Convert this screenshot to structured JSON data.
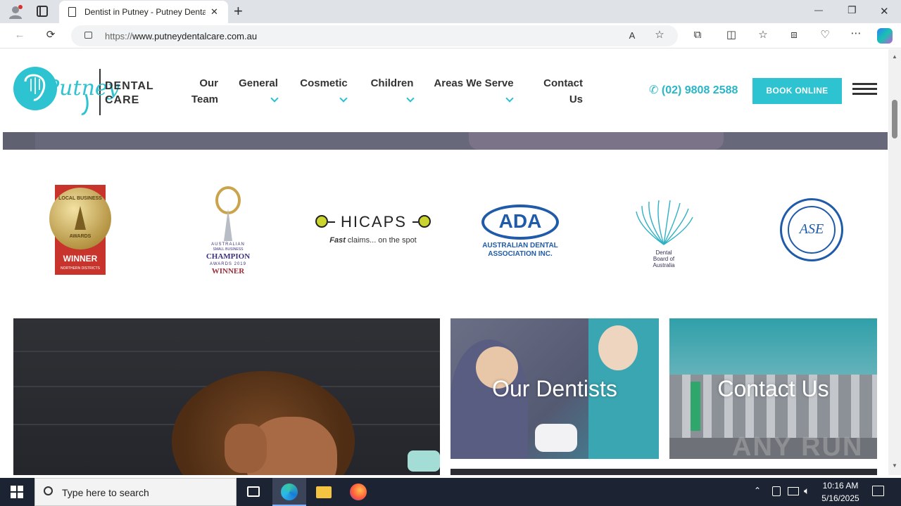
{
  "browser": {
    "tab_title": "Dentist in Putney - Putney Dental",
    "url_prefix": "https://",
    "url_host": "www.putneydentalcare.com.au",
    "new_tab_glyph": "+",
    "min_glyph": "—",
    "restore_glyph": "❐",
    "close_glyph": "✕",
    "tab_close_glyph": "✕"
  },
  "site": {
    "logo_script": "Putney",
    "logo_line1": "DENTAL",
    "logo_line2": "CARE",
    "nav": [
      {
        "line1": "Our",
        "line2": "Team",
        "dropdown": false
      },
      {
        "line1": "General",
        "line2": "",
        "dropdown": true
      },
      {
        "line1": "Cosmetic",
        "line2": "",
        "dropdown": true
      },
      {
        "line1": "Children",
        "line2": "",
        "dropdown": true
      },
      {
        "line1": "Areas We Serve",
        "line2": "",
        "dropdown": true
      },
      {
        "line1": "Contact",
        "line2": "Us",
        "dropdown": false
      }
    ],
    "phone": "(02) 9808 2588",
    "book_label": "BOOK ONLINE",
    "accent": "#2ec3d1"
  },
  "badges": {
    "local_business": {
      "top": "LOCAL BUSINESS",
      "mid": "AWARDS",
      "winner": "WINNER",
      "sub": "NORTHERN DISTRICTS"
    },
    "champion": {
      "l1": "AUSTRALIAN",
      "l2": "SMALL BUSINESS",
      "l3": "CHAMPION",
      "l4": "AWARDS 2019",
      "l5": "WINNER"
    },
    "hicaps": {
      "name": "HICAPS",
      "tag_bold": "Fast",
      "tag_rest": " claims... on the spot"
    },
    "ada": {
      "abbr": "ADA",
      "l1": "AUSTRALIAN DENTAL",
      "l2": "ASSOCIATION INC."
    },
    "dental_board": {
      "l1": "Dental",
      "l2": "Board of",
      "l3": "Australia"
    },
    "society": {
      "mono": "ASE"
    }
  },
  "tiles": {
    "dentists_label": "Our Dentists",
    "contact_label": "Contact Us"
  },
  "watermark": "ANY RUN",
  "taskbar": {
    "search_placeholder": "Type here to search",
    "time": "10:16 AM",
    "date": "5/16/2025"
  }
}
